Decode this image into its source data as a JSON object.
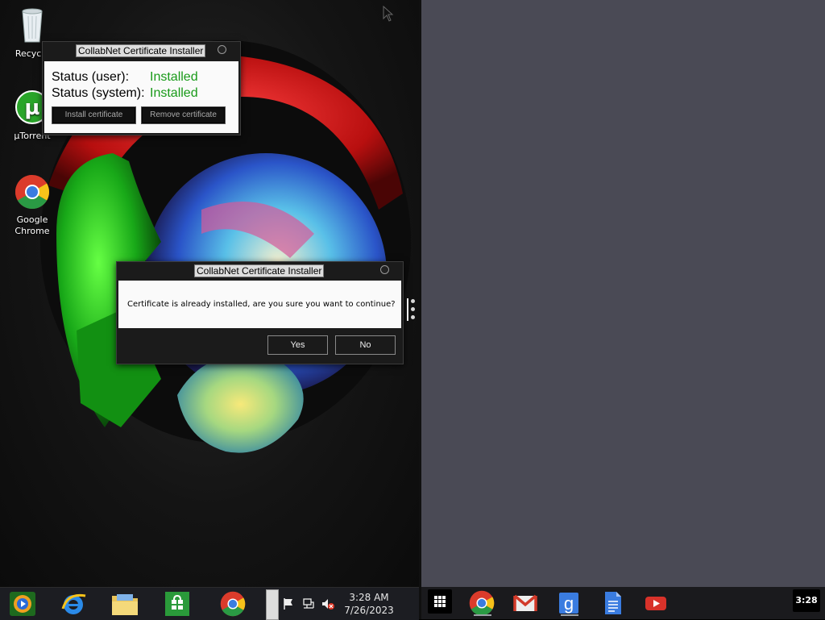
{
  "desktop": {
    "icons": [
      {
        "label": "Recycle",
        "icon": "recycle-bin-icon"
      },
      {
        "label": "µTorrent",
        "icon": "utorrent-icon"
      },
      {
        "label": "Google Chrome",
        "icon": "chrome-icon"
      }
    ]
  },
  "status_window": {
    "title": "CollabNet Certificate Installer",
    "user_label": "Status (user):",
    "user_value": "Installed",
    "system_label": "Status (system):",
    "system_value": "Installed",
    "install_button": "Install certificate",
    "remove_button": "Remove certificate",
    "status_color": "#189a18"
  },
  "dialog": {
    "title": "CollabNet Certificate Installer",
    "message": "Certificate is already installed, are you sure you want to continue?",
    "yes": "Yes",
    "no": "No"
  },
  "taskbar": {
    "pinned": [
      "media-player-icon",
      "internet-explorer-icon",
      "file-explorer-icon",
      "windows-store-icon",
      "chrome-icon"
    ],
    "tray": [
      "action-center-flag-icon",
      "network-icon",
      "volume-muted-icon"
    ],
    "time": "3:28 AM",
    "date": "7/26/2023"
  },
  "shelf": {
    "apps": [
      "app-launcher-icon",
      "chrome-icon",
      "gmail-icon",
      "google-search-icon",
      "google-docs-icon",
      "youtube-icon"
    ],
    "time": "3:28"
  },
  "colors": {
    "right_desktop": "#4a4a55",
    "taskbar": "#1c1d22"
  }
}
